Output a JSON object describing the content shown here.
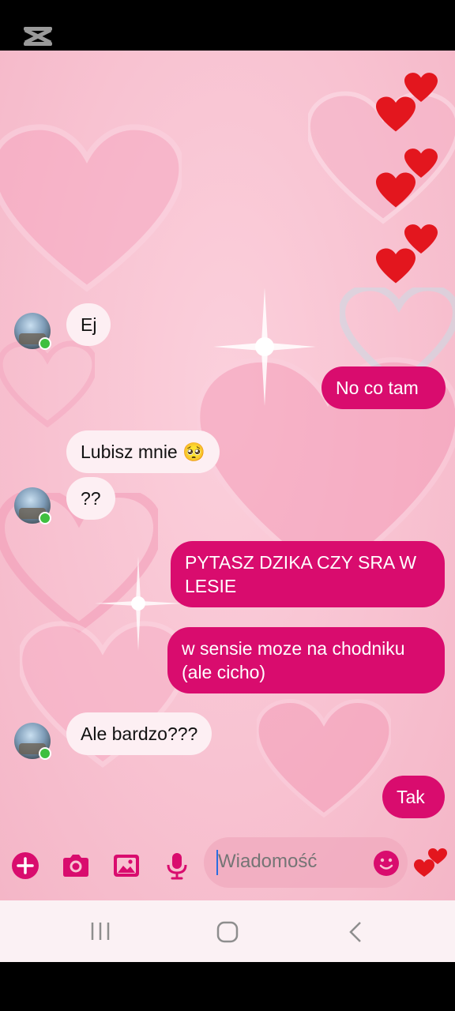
{
  "app": {
    "overlay_logo": "capcut-logo"
  },
  "colors": {
    "accent": "#d90c6e",
    "incoming_bubble": "#fdeff3",
    "online": "#3fbf3f",
    "chat_bg": "#f8c2d1"
  },
  "messages": [
    {
      "direction": "incoming",
      "text": "Ej",
      "avatar": true
    },
    {
      "direction": "outgoing",
      "text": "No co tam"
    },
    {
      "direction": "incoming",
      "text": "Lubisz mnie 🥺",
      "avatar": false
    },
    {
      "direction": "incoming",
      "text": "??",
      "avatar": true
    },
    {
      "direction": "outgoing",
      "text": "PYTASZ DZIKA CZY SRA W LESIE"
    },
    {
      "direction": "outgoing",
      "text": "w sensie moze na chodniku (ale cicho)"
    },
    {
      "direction": "incoming",
      "text": "Ale bardzo???",
      "avatar": true
    },
    {
      "direction": "outgoing",
      "text": "Tak"
    }
  ],
  "composer": {
    "placeholder": "Wiadomość",
    "icons": [
      "plus-icon",
      "camera-icon",
      "gallery-icon",
      "microphone-icon",
      "emoji-icon",
      "hearts-reaction-icon"
    ]
  },
  "navigation": {
    "icons": [
      "recent-apps-icon",
      "home-icon",
      "back-icon"
    ]
  }
}
